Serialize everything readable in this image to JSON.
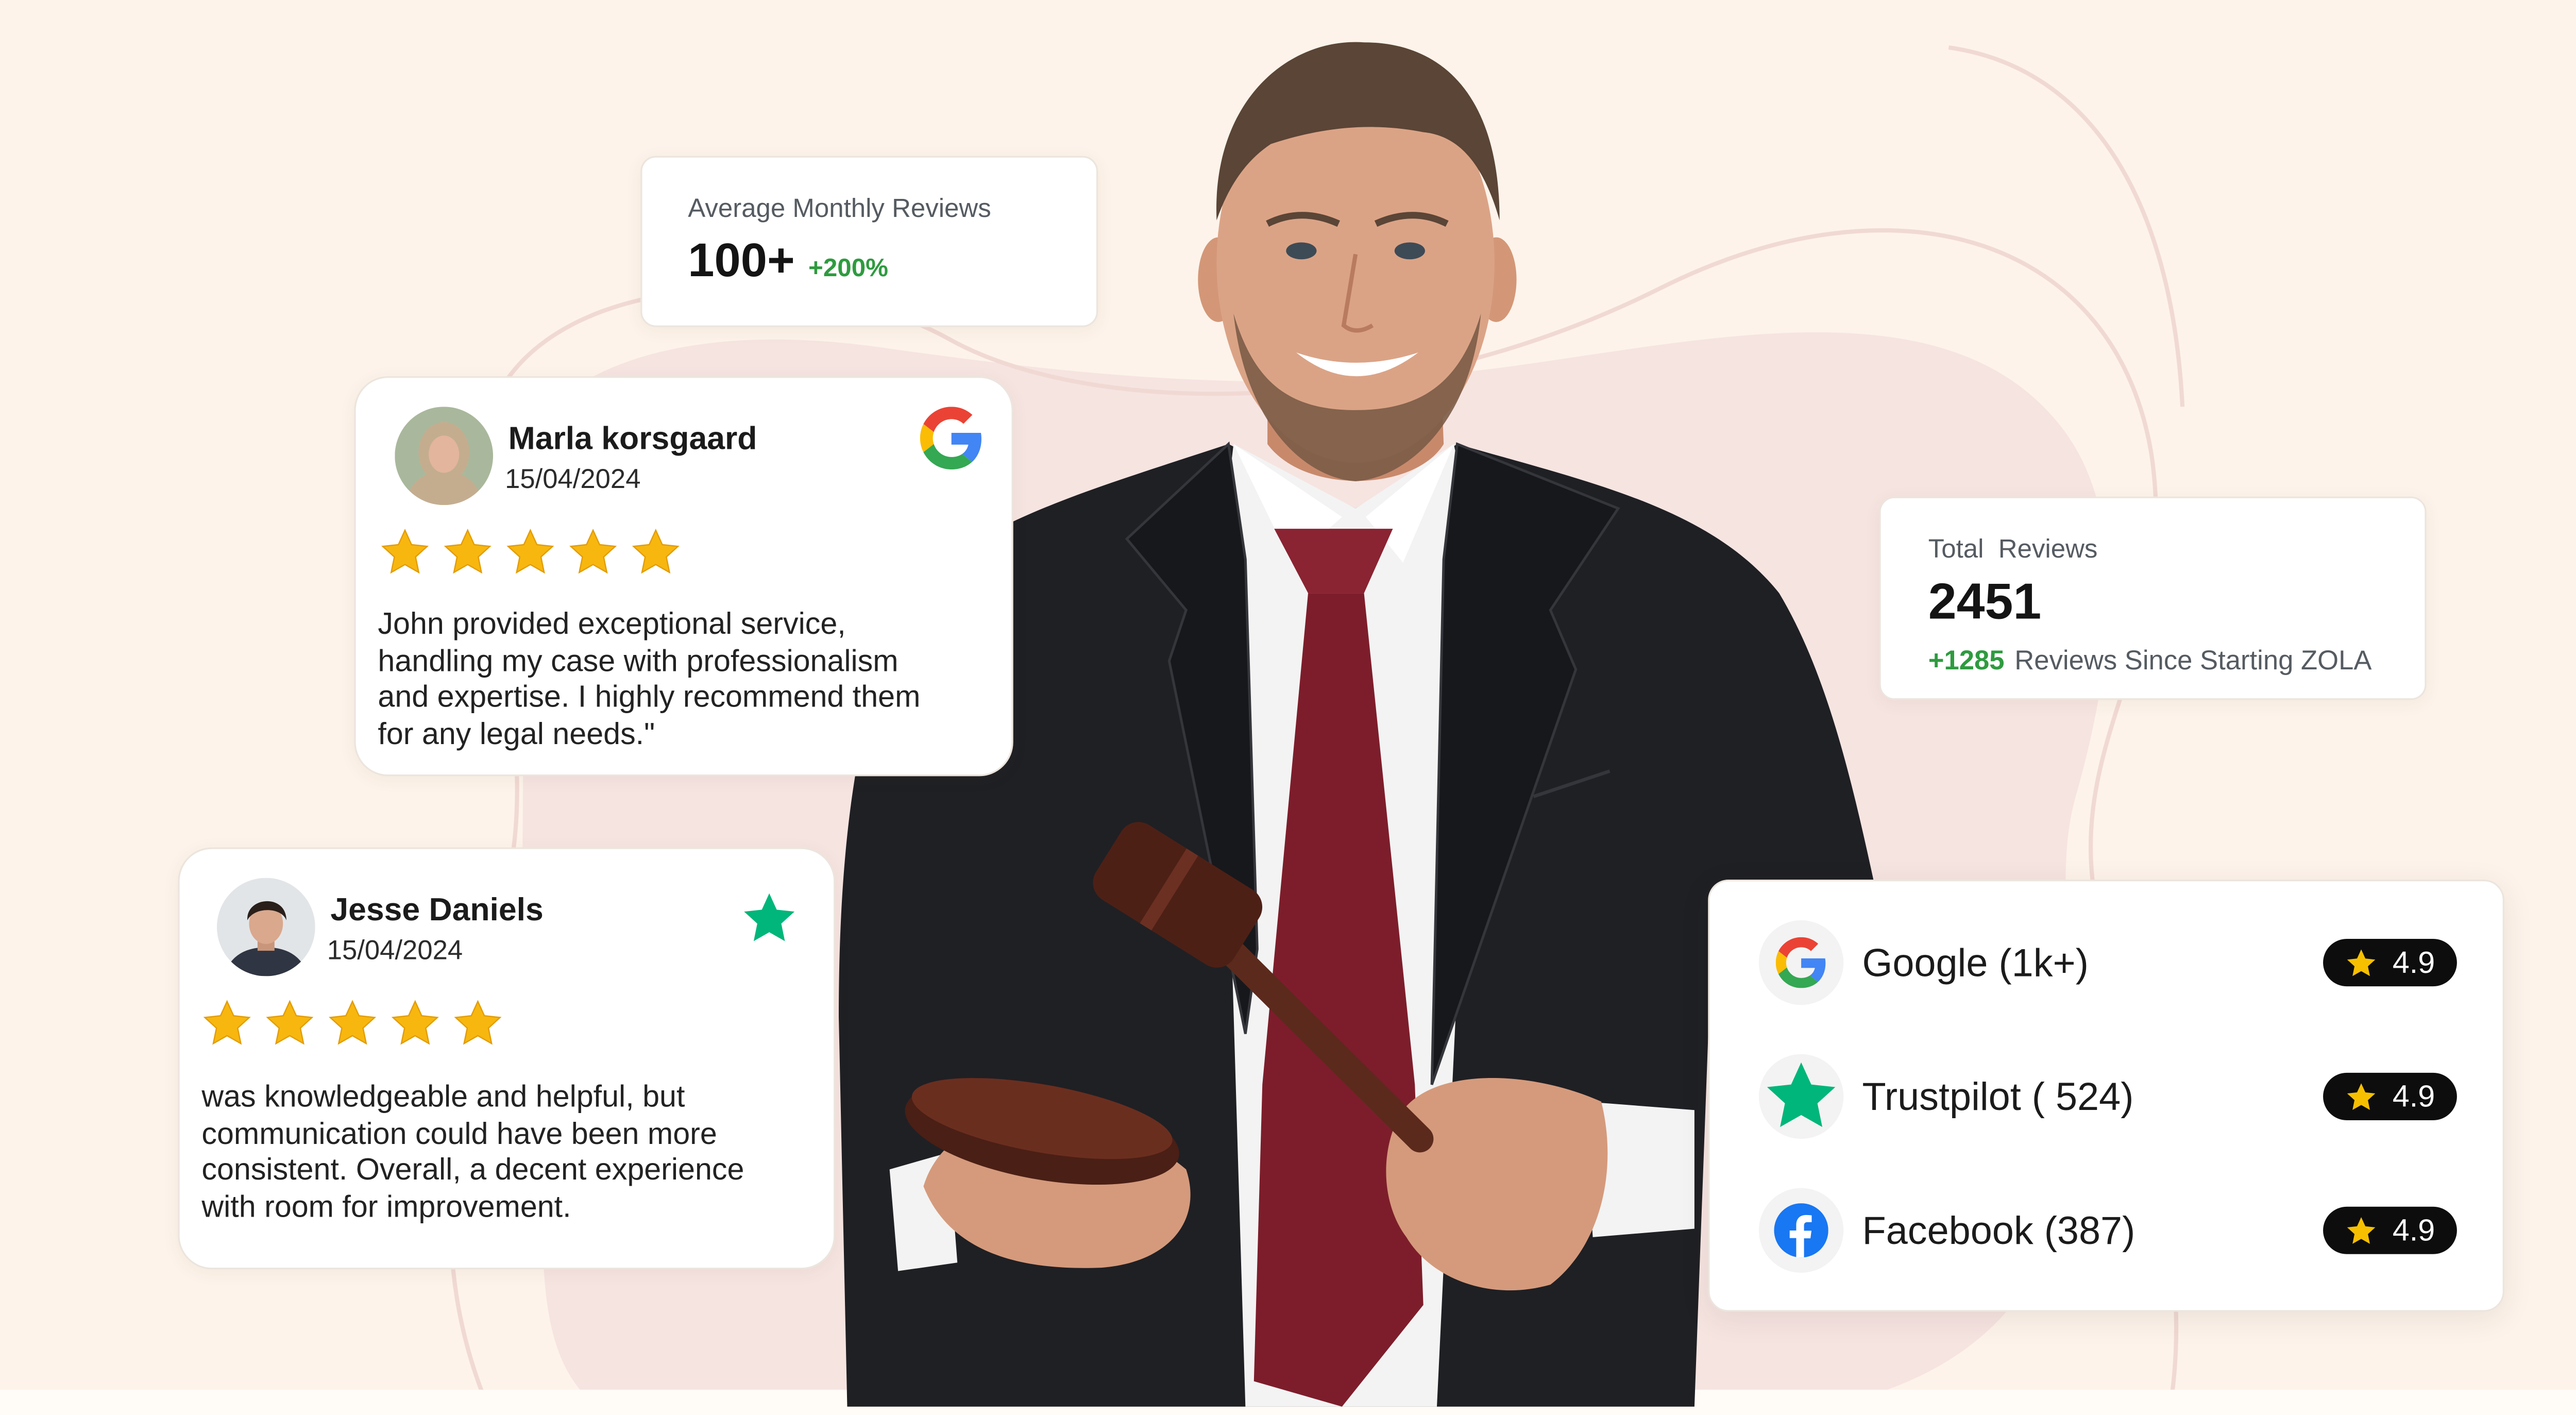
{
  "colors": {
    "background": "#fdf3ea",
    "accent_green": "#2e9b3f",
    "star_gold": "#f7b70f",
    "trustpilot_green": "#00b67a",
    "facebook_blue": "#1877f2"
  },
  "monthly_stat": {
    "label": "Average Monthly Reviews",
    "value": "100+",
    "change": "+200%"
  },
  "reviews": [
    {
      "name": "Marla korsgaard",
      "date": "15/04/2024",
      "source_icon": "google-icon",
      "rating": 5,
      "text_lines": [
        "John provided exceptional service,",
        "handling my case with professionalism",
        "and expertise. I highly recommend them",
        "for any legal needs.\""
      ]
    },
    {
      "name": "Jesse Daniels",
      "date": "15/04/2024",
      "source_icon": "trustpilot-icon",
      "rating": 5,
      "text_lines": [
        "was knowledgeable and helpful, but",
        "communication could have been more",
        "consistent. Overall, a decent experience",
        "with room for improvement."
      ]
    }
  ],
  "total_stat": {
    "label": "Total  Reviews",
    "value": "2451",
    "change": "+1285",
    "change_text": "Reviews Since Starting ZOLA"
  },
  "platforms": [
    {
      "name": "Google (1k+)",
      "icon": "google-icon",
      "rating": "4.9"
    },
    {
      "name": "Trustpilot ( 524)",
      "icon": "trustpilot-icon",
      "rating": "4.9"
    },
    {
      "name": "Facebook (387)",
      "icon": "facebook-icon",
      "rating": "4.9"
    }
  ],
  "hero": {
    "icon": "lawyer-with-gavel-photo"
  }
}
